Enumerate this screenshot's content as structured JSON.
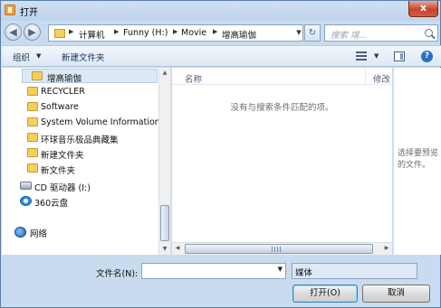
{
  "window": {
    "title": "打开",
    "close_label": "x"
  },
  "address": {
    "crumbs": [
      "计算机",
      "Funny (H:)",
      "Movie",
      "增高瑜伽"
    ]
  },
  "search": {
    "placeholder": "搜索 增..."
  },
  "toolbar": {
    "organize_label": "组织",
    "new_folder_label": "新建文件夹"
  },
  "navpane": {
    "items": [
      {
        "label": "增高瑜伽",
        "type": "folder"
      },
      {
        "label": "RECYCLER",
        "type": "folder"
      },
      {
        "label": "Software",
        "type": "folder"
      },
      {
        "label": "System Volume Information",
        "type": "folder"
      },
      {
        "label": "环球音乐极品典藏集",
        "type": "folder"
      },
      {
        "label": "新建文件夹",
        "type": "folder"
      },
      {
        "label": "新文件夹",
        "type": "folder"
      },
      {
        "label": "CD 驱动器 (I:)",
        "type": "drive"
      },
      {
        "label": "360云盘",
        "type": "cloud"
      },
      {
        "label": "网络",
        "type": "network"
      }
    ]
  },
  "filelist": {
    "col_name": "名称",
    "col_modified": "修改",
    "empty_message": "没有与搜索条件匹配的项。"
  },
  "preview": {
    "message": "选择要预览的文件。"
  },
  "bottom": {
    "filename_label": "文件名(N):",
    "filename_value": "",
    "filetype_selected": "媒体",
    "open_label": "打开(O)",
    "cancel_label": "取消"
  },
  "colors": {
    "window_bg": "#c9dcef",
    "folder": "#f4cf5b",
    "close_button": "#c7442e",
    "selection": "#dce9f7"
  }
}
